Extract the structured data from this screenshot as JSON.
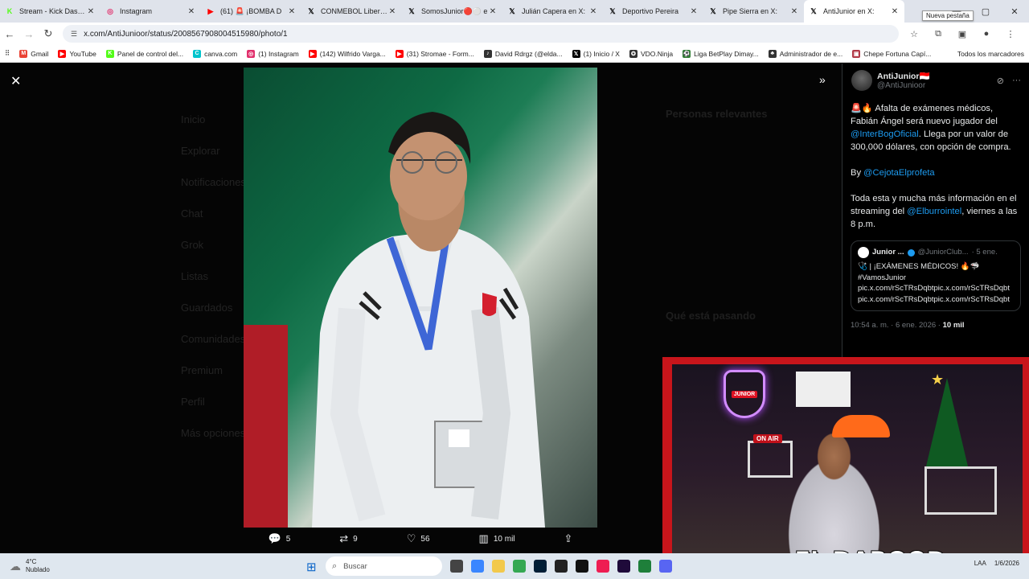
{
  "browser": {
    "tabs": [
      {
        "label": "Stream - Kick Dashbo",
        "icon": "kick-icon",
        "color": "#53fc18",
        "glyph": "K"
      },
      {
        "label": "Instagram",
        "icon": "instagram-icon",
        "color": "#e1306c",
        "glyph": "◎"
      },
      {
        "label": "(61) 🚨 ¡BOMBA D",
        "icon": "youtube-icon",
        "color": "#ff0000",
        "glyph": "▶"
      },
      {
        "label": "CONMEBOL Libertad",
        "icon": "x-icon",
        "color": "#000000",
        "glyph": "𝕏"
      },
      {
        "label": "SomosJunior🔴⚪ e",
        "icon": "x-icon",
        "color": "#000000",
        "glyph": "𝕏"
      },
      {
        "label": "Julián Capera en X: ",
        "icon": "x-icon",
        "color": "#000000",
        "glyph": "𝕏"
      },
      {
        "label": "Deportivo Pereira ",
        "icon": "x-icon",
        "color": "#000000",
        "glyph": "𝕏"
      },
      {
        "label": "Pipe Sierra en X: ",
        "icon": "x-icon",
        "color": "#000000",
        "glyph": "𝕏"
      },
      {
        "label": "AntiJunior en X: ",
        "icon": "x-icon",
        "color": "#000000",
        "glyph": "𝕏"
      }
    ],
    "tooltip": "Nueva pestaña",
    "url": "x.com/AntiJunioor/status/2008567908004515980/photo/1",
    "bookmarks": [
      {
        "label": "Gmail",
        "color": "#ea4335",
        "glyph": "M"
      },
      {
        "label": "YouTube",
        "color": "#ff0000",
        "glyph": "▶"
      },
      {
        "label": "Panel de control del...",
        "color": "#53fc18",
        "glyph": "K"
      },
      {
        "label": "canva.com",
        "color": "#00c4cc",
        "glyph": "C"
      },
      {
        "label": "(1) Instagram",
        "color": "#e1306c",
        "glyph": "◎"
      },
      {
        "label": "(142) Wilfrido Varga...",
        "color": "#ff0000",
        "glyph": "▶"
      },
      {
        "label": "(31) Stromae - Form...",
        "color": "#ff0000",
        "glyph": "▶"
      },
      {
        "label": "David Rdrgz (@elda...",
        "color": "#333333",
        "glyph": "♪"
      },
      {
        "label": "(1) Inicio / X",
        "color": "#000000",
        "glyph": "𝕏"
      },
      {
        "label": "VDO.Ninja",
        "color": "#333333",
        "glyph": "✪"
      },
      {
        "label": "Liga BetPlay Dimay...",
        "color": "#2e7d32",
        "glyph": "⚽"
      },
      {
        "label": "Administrador de e...",
        "color": "#333333",
        "glyph": "♣"
      },
      {
        "label": "Chepe Fortuna Capí...",
        "color": "#b23a48",
        "glyph": "▣"
      }
    ],
    "bookmarks_folder": "Todos los marcadores"
  },
  "background_nav": [
    "Inicio",
    "Explorar",
    "Notificaciones",
    "Chat",
    "Grok",
    "Listas",
    "Guardados",
    "Comunidades",
    "Premium",
    "Perfil",
    "Más opciones"
  ],
  "background_sidebar": {
    "relevant": "Personas relevantes",
    "happening": "Qué está pasando"
  },
  "photo_actions": {
    "replies": "5",
    "reposts": "9",
    "likes": "56",
    "views": "10 mil"
  },
  "tweet": {
    "author_name": "AntiJunior",
    "author_flag": "🇮🇩",
    "author_handle": "@AntiJunioor",
    "p1_emoji": "🚨🔥",
    "p1_text_a": " Afalta de exámenes médicos, Fabián Ángel será nuevo jugador del ",
    "p1_mention": "@InterBogOficial",
    "p1_text_b": ". Llega por un valor de 300,000 dólares, con opción de compra.",
    "by_prefix": "By ",
    "by_mention": "@CejotaElprofeta",
    "p3_text_a": "Toda esta y mucha más información en el streaming del ",
    "p3_mention": "@Elburrointel",
    "p3_text_b": ", viernes a las 8 p.m.",
    "quote_name": "Junior ...",
    "quote_handle": "@JuniorClub...",
    "quote_date": "· 5 ene.",
    "quote_line1": "🩺 | ¡EXÁMENES MÉDICOS! 🔥🦈",
    "quote_line2": "#VamosJunior",
    "quote_line3": "pic.x.com/rScTRsDqbtpic.x.com/rScTRsDqbtpic.x.com/rScTRsDqbtpic.x.com/rScTRsDqbt",
    "meta_time": "10:54 a. m. · 6 ene. 2026 · ",
    "meta_views": "10 mil"
  },
  "stream": {
    "watermark": "EL DAROOD",
    "on_air": "ON AIR",
    "logo": "JUNIOR"
  },
  "taskbar": {
    "temp": "4°C",
    "condition": "Nublado",
    "search_placeholder": "Buscar",
    "lang": "LAA",
    "date": "1/6/2026"
  }
}
